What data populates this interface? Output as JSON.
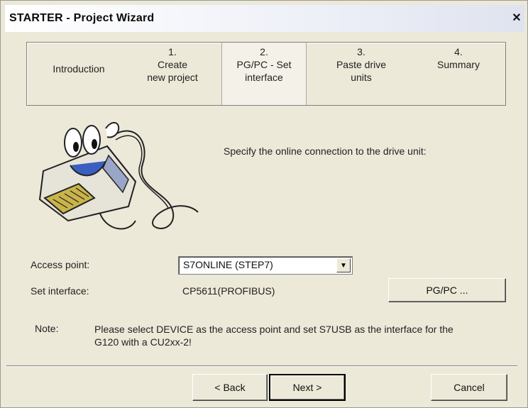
{
  "window": {
    "title": "STARTER - Project Wizard",
    "close_glyph": "✕"
  },
  "steps": [
    {
      "number": "",
      "label": "Introduction"
    },
    {
      "number": "1.",
      "label": "Create\nnew project"
    },
    {
      "number": "2.",
      "label": "PG/PC - Set\ninterface",
      "active": true
    },
    {
      "number": "3.",
      "label": "Paste drive\nunits"
    },
    {
      "number": "4.",
      "label": "Summary"
    }
  ],
  "prompt": "Specify the online connection to the drive unit:",
  "access_point": {
    "label": "Access point:",
    "value": "S7ONLINE (STEP7)"
  },
  "set_interface": {
    "label": "Set interface:",
    "value": "CP5611(PROFIBUS)",
    "button": "PG/PC ..."
  },
  "note": {
    "label": "Note:",
    "text": "Please select DEVICE as the access point and set S7USB as the interface for the G120 with a CU2xx-2!"
  },
  "buttons": {
    "back": "< Back",
    "next": "Next >",
    "cancel": "Cancel"
  },
  "colors": {
    "face": "#ece9d8",
    "active_step": "#f4f2e8"
  }
}
